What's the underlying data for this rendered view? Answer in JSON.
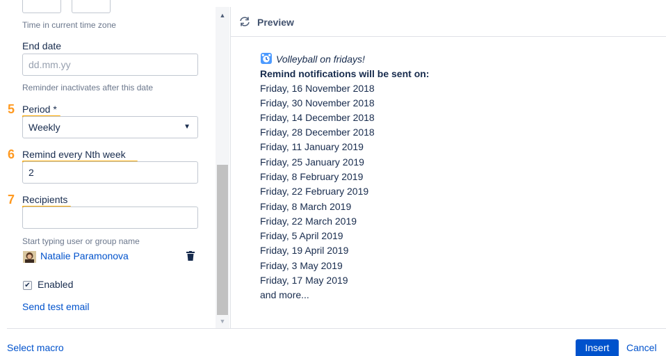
{
  "form": {
    "time_help": "Time in current time zone",
    "end_date_label": "End date",
    "end_date_placeholder": "dd.mm.yy",
    "end_date_help": "Reminder inactivates after this date",
    "period": {
      "step": "5",
      "label": "Period *",
      "value": "Weekly"
    },
    "remind_every": {
      "step": "6",
      "label": "Remind every Nth week",
      "value": "2"
    },
    "recipients": {
      "step": "7",
      "label": "Recipients",
      "value": "",
      "help": "Start typing user or group name",
      "users": [
        {
          "name": "Natalie Paramonova"
        }
      ]
    },
    "enabled_label": "Enabled",
    "enabled_checked": true,
    "send_test_email": "Send test email"
  },
  "preview": {
    "title": "Preview",
    "reminder_name": "Volleyball on fridays!",
    "notifications_heading": "Remind notifications will be sent on:",
    "dates": [
      "Friday, 16 November 2018",
      "Friday, 30 November 2018",
      "Friday, 14 December 2018",
      "Friday, 28 December 2018",
      "Friday, 11 January 2019",
      "Friday, 25 January 2019",
      "Friday, 8 February 2019",
      "Friday, 22 February 2019",
      "Friday, 8 March 2019",
      "Friday, 22 March 2019",
      "Friday, 5 April 2019",
      "Friday, 19 April 2019",
      "Friday, 3 May 2019",
      "Friday, 17 May 2019"
    ],
    "more": "and more..."
  },
  "footer": {
    "select_macro": "Select macro",
    "insert": "Insert",
    "cancel": "Cancel"
  },
  "icons": {
    "refresh": "refresh-icon",
    "alarm": "alarm-clock-icon",
    "trash": "trash-icon",
    "dropdown": "chevron-down-icon"
  },
  "colors": {
    "accent": "#0052cc",
    "step_marker": "#ff991f",
    "underline": "#ffab00"
  }
}
